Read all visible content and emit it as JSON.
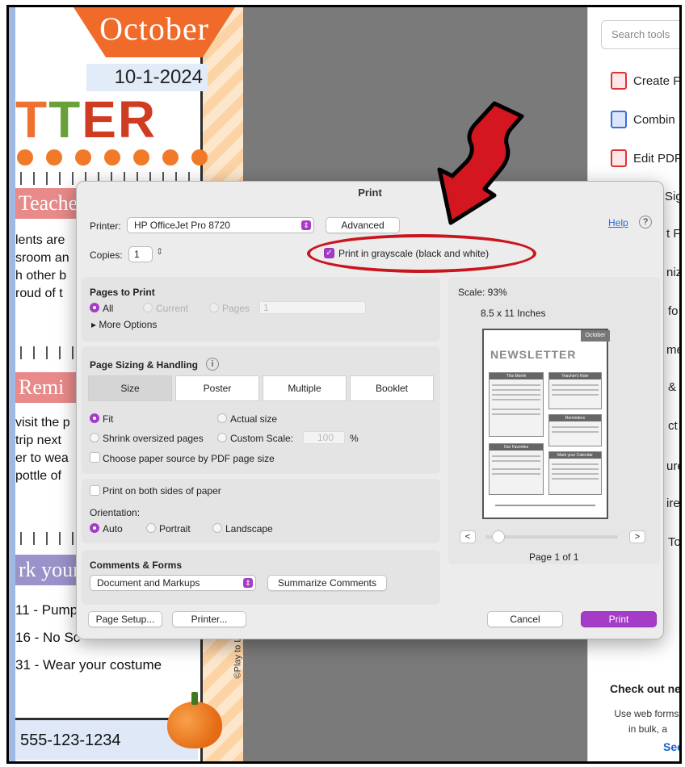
{
  "newsletter": {
    "month": "October",
    "date": "10-1-2024",
    "title_letters": [
      "T",
      "T",
      "E",
      "R"
    ],
    "teacher_heading": "Teacher",
    "teacher_lines": [
      "lents are",
      "sroom an",
      "h other b",
      "roud of t"
    ],
    "reminders_heading": "Remi",
    "reminders_lines": [
      "visit the p",
      "trip next",
      "er to wea",
      "pottle of"
    ],
    "calendar_heading": "rk your",
    "calendar_lines": [
      "11 - Pumpl",
      "16 - No Sc",
      "31 - Wear your costume"
    ],
    "phone": "555-123-1234",
    "credit": "©Play to L"
  },
  "tools_panel": {
    "search_placeholder": "Search tools",
    "items": [
      "Create F",
      "Combin",
      "Edit PDF"
    ],
    "fragments": [
      "Sig",
      "t F",
      "nize",
      "fo",
      "me",
      "& (",
      "ct",
      "ure",
      "ire",
      "To"
    ],
    "checkout_title": "Check out ne",
    "checkout_text": [
      "Use web forms,",
      "in bulk, a"
    ],
    "checkout_link": "See"
  },
  "print_dialog": {
    "title": "Print",
    "printer_label": "Printer:",
    "printer_value": "HP OfficeJet Pro 8720",
    "advanced_button": "Advanced",
    "help_link": "Help",
    "help_icon": "?",
    "copies_label": "Copies:",
    "copies_value": "1",
    "grayscale_label": "Print in grayscale (black and white)",
    "pages_to_print": {
      "heading": "Pages to Print",
      "all": "All",
      "current": "Current",
      "pages": "Pages",
      "pages_value": "1",
      "more_options": "More Options"
    },
    "sizing": {
      "heading": "Page Sizing & Handling",
      "info_icon": "i",
      "tabs": [
        "Size",
        "Poster",
        "Multiple",
        "Booklet"
      ],
      "fit": "Fit",
      "actual_size": "Actual size",
      "shrink": "Shrink oversized pages",
      "custom_scale": "Custom Scale:",
      "custom_scale_value": "100",
      "percent": "%",
      "choose_source": "Choose paper source by PDF page size"
    },
    "both_sides": "Print on both sides of paper",
    "orientation": {
      "heading": "Orientation:",
      "auto": "Auto",
      "portrait": "Portrait",
      "landscape": "Landscape"
    },
    "comments": {
      "heading": "Comments & Forms",
      "value": "Document and Markups",
      "summarize_button": "Summarize Comments"
    },
    "preview": {
      "scale": "Scale: 93%",
      "paper": "8.5 x 11 Inches",
      "page_of": "Page 1 of 1",
      "prev": "<",
      "next": ">",
      "mini_month": "October",
      "mini_title": "NEWSLETTER",
      "mini_heads": [
        "This Month",
        "Teacher's Note",
        "Reminders",
        "Our Favorites",
        "Mark your Calendar"
      ]
    },
    "buttons": {
      "page_setup": "Page Setup...",
      "printer": "Printer...",
      "cancel": "Cancel",
      "print": "Print"
    }
  },
  "annotation": {
    "arrow_color": "#d3161f",
    "ellipse_color": "#c8161d"
  }
}
